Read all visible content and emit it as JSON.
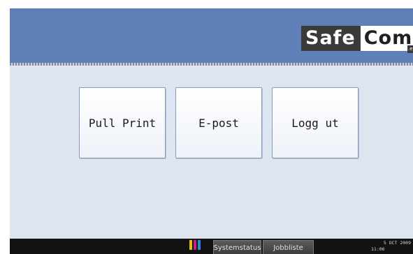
{
  "header": {
    "logo_part1": "Safe",
    "logo_part2": "Com",
    "logo_suffix": ".e"
  },
  "menu": {
    "buttons": [
      {
        "label": "Pull Print"
      },
      {
        "label": "E-post"
      },
      {
        "label": "Logg ut"
      }
    ]
  },
  "statusbar": {
    "toner_icon": "toner-level-icon",
    "toner_colors": [
      "#e8c000",
      "#d01a8a",
      "#2a8ad6",
      "#111111"
    ],
    "systemstatus_label": "Systemstatus",
    "jobbliste_label": "Jobbliste",
    "date": "5 OCT  2009",
    "time": "11:06"
  }
}
